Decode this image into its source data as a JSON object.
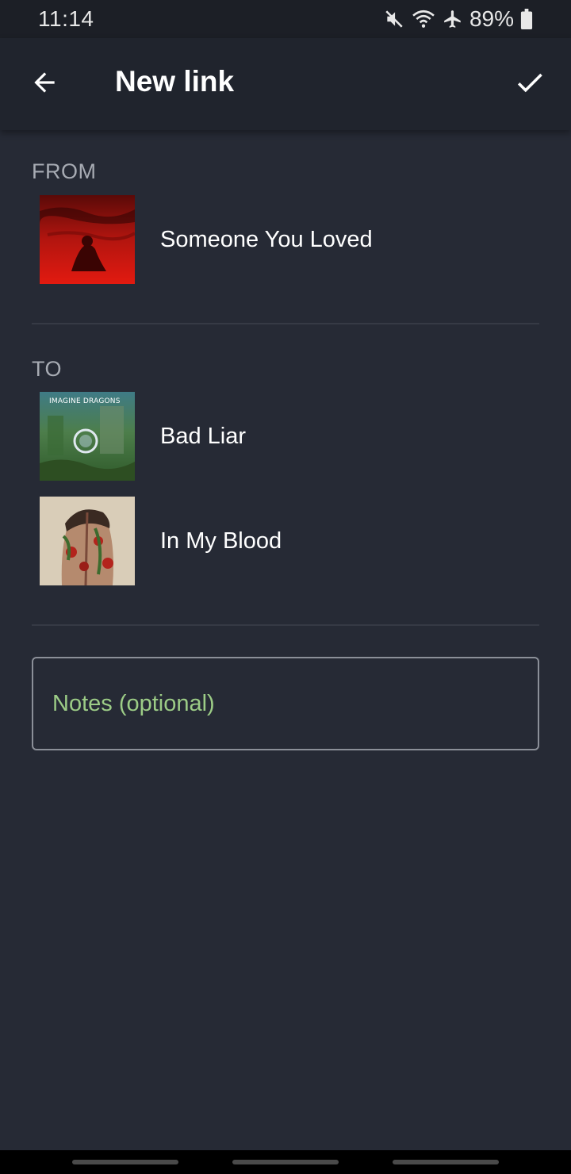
{
  "status_bar": {
    "time": "11:14",
    "battery": "89%",
    "icons": [
      "mute-icon",
      "wifi-icon",
      "airplane-icon",
      "battery-icon"
    ]
  },
  "app_bar": {
    "title": "New link",
    "back_icon": "arrow-back-icon",
    "confirm_icon": "check-icon"
  },
  "from_section": {
    "label": "FROM",
    "songs": [
      {
        "title": "Someone You Loved"
      }
    ]
  },
  "to_section": {
    "label": "TO",
    "songs": [
      {
        "title": "Bad Liar",
        "cover_text": "IMAGINE DRAGONS"
      },
      {
        "title": "In My Blood"
      }
    ]
  },
  "notes": {
    "placeholder": "Notes (optional)",
    "value": ""
  },
  "colors": {
    "background": "#262a35",
    "app_bar": "#20242d",
    "placeholder_accent": "#9ccc86",
    "section_label": "#a7abb3"
  }
}
